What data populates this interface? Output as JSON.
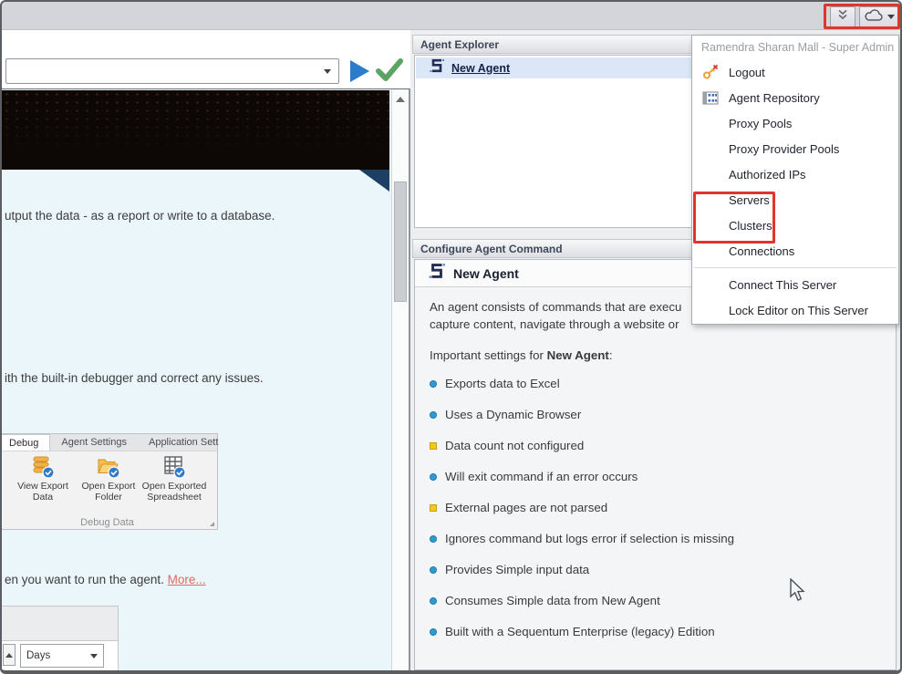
{
  "ribbon": {
    "collapse_button_icon": "chevron-double-down-icon",
    "cloud_button_icon": "cloud-icon"
  },
  "toolbar": {
    "combobox_value": ""
  },
  "document": {
    "paragraph1": "utput the data - as a report or write to a database.",
    "paragraph2": "ith the built-in debugger and correct any issues.",
    "paragraph3_prefix": "en you want to run the agent. ",
    "more_link": "More...",
    "ribbon_screenshot": {
      "tabs": [
        {
          "label": "Debug",
          "active": true
        },
        {
          "label": "Agent Settings",
          "active": false
        },
        {
          "label": "Application Sett",
          "active": false
        }
      ],
      "buttons": [
        {
          "label": "View Export Data",
          "icon": "export-data-icon"
        },
        {
          "label": "Open Export Folder",
          "icon": "export-folder-icon"
        },
        {
          "label": "Open Exported Spreadsheet",
          "icon": "spreadsheet-icon"
        }
      ],
      "group_label": "Debug Data"
    },
    "schedule_screenshot": {
      "dropdown_value": "Days"
    }
  },
  "agent_explorer": {
    "title": "Agent Explorer",
    "item": {
      "label": "New Agent",
      "icon": "sequentum-agent-icon"
    }
  },
  "configure_panel": {
    "title": "Configure Agent Command",
    "agent_name": "New Agent",
    "description_line1": "An agent consists of commands that are execu",
    "description_line2": "capture content, navigate through a website or",
    "important_prefix": "Important settings for ",
    "important_bold": "New Agent",
    "important_suffix": ":",
    "bullets": [
      {
        "type": "info",
        "text": "Exports data to Excel"
      },
      {
        "type": "info",
        "text": "Uses a Dynamic Browser"
      },
      {
        "type": "warning",
        "text": "Data count not configured"
      },
      {
        "type": "info",
        "text": "Will exit command if an error occurs"
      },
      {
        "type": "warning",
        "text": "External pages are not parsed"
      },
      {
        "type": "info",
        "text": "Ignores command but logs error if selection is missing"
      },
      {
        "type": "info",
        "text": "Provides Simple input data"
      },
      {
        "type": "info",
        "text": "Consumes Simple data from New Agent"
      },
      {
        "type": "info",
        "text": "Built with a Sequentum Enterprise (legacy) Edition"
      }
    ]
  },
  "user_menu": {
    "header": "Ramendra Sharan Mall - Super Admin",
    "items": [
      {
        "label": "Logout",
        "icon": "logout-key-icon"
      },
      {
        "label": "Agent Repository",
        "icon": "repository-grid-icon"
      },
      {
        "label": "Proxy Pools"
      },
      {
        "label": "Proxy Provider Pools"
      },
      {
        "label": "Authorized IPs"
      },
      {
        "label": "Servers",
        "highlighted": true
      },
      {
        "label": "Clusters",
        "highlighted": true
      },
      {
        "label": "Connections"
      },
      {
        "label": "Connect This Server"
      },
      {
        "label": "Lock Editor on This Server"
      }
    ]
  },
  "annotations": {
    "highlight_color": "#e0352c"
  }
}
